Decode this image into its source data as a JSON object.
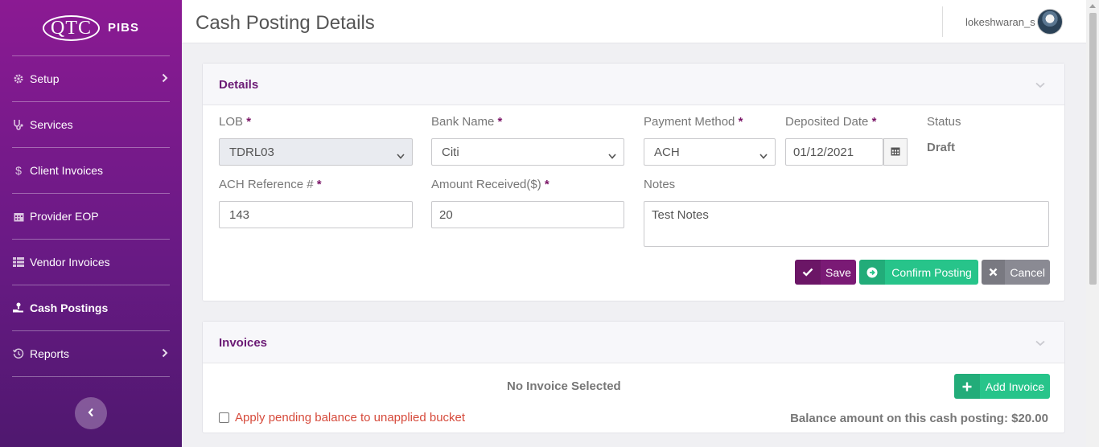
{
  "brand": {
    "logo": "QTC",
    "name": "PIBS"
  },
  "sidebar": {
    "items": [
      {
        "label": "Setup",
        "icon": "gear-icon",
        "has_submenu": true,
        "active": false
      },
      {
        "label": "Services",
        "icon": "stethoscope-icon",
        "has_submenu": false,
        "active": false
      },
      {
        "label": "Client Invoices",
        "icon": "dollar-icon",
        "has_submenu": false,
        "active": false
      },
      {
        "label": "Provider EOP",
        "icon": "calendar-icon",
        "has_submenu": false,
        "active": false
      },
      {
        "label": "Vendor Invoices",
        "icon": "table-icon",
        "has_submenu": false,
        "active": false
      },
      {
        "label": "Cash Postings",
        "icon": "hand-coin-icon",
        "has_submenu": false,
        "active": true
      },
      {
        "label": "Reports",
        "icon": "history-icon",
        "has_submenu": true,
        "active": false
      }
    ]
  },
  "header": {
    "title": "Cash Posting Details",
    "user": "lokeshwaran_s"
  },
  "details": {
    "title": "Details",
    "lob": {
      "label": "LOB",
      "value": "TDRL03"
    },
    "bank": {
      "label": "Bank Name",
      "value": "Citi"
    },
    "payment_method": {
      "label": "Payment Method",
      "value": "ACH"
    },
    "deposited_date": {
      "label": "Deposited Date",
      "value": "01/12/2021"
    },
    "status": {
      "label": "Status",
      "value": "Draft"
    },
    "ach_ref": {
      "label": "ACH Reference #",
      "value": "143"
    },
    "amount": {
      "label": "Amount Received($)",
      "value": "20"
    },
    "notes": {
      "label": "Notes",
      "value": "Test Notes"
    },
    "required_mark": "*",
    "buttons": {
      "save": "Save",
      "confirm": "Confirm Posting",
      "cancel": "Cancel"
    }
  },
  "invoices": {
    "title": "Invoices",
    "empty_text": "No Invoice Selected",
    "add_button": "Add Invoice",
    "pending_label": "Apply pending balance to unapplied bucket",
    "balance_text": "Balance amount on this cash posting: $20.00"
  },
  "colors": {
    "brand_purple": "#7a1a75",
    "green": "#27c48a",
    "gray_button": "#8a8a93",
    "danger_text": "#d64a3b"
  }
}
